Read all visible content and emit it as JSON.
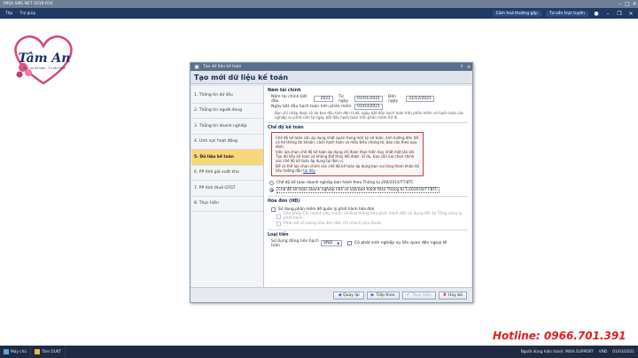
{
  "app": {
    "title": "MISA SME.NET 2019 R16",
    "menus": [
      "Tệp",
      "Trợ giúp"
    ],
    "help_link": "Cảm hoá thường gặp",
    "support_link": "Tư vấn trực tuyến"
  },
  "logo": {
    "brand": "Tâm An",
    "tagline": "Dịch vụ kế toán - Tư vấn thuế"
  },
  "dialog": {
    "window_title": "Tạo dữ liệu kế toán",
    "heading": "Tạo mới dữ liệu kế toán",
    "steps": [
      "1. Thông tin dữ liệu",
      "2. Thông tin người dùng",
      "3. Thông tin doanh nghiệp",
      "4. Lĩnh vực hoạt động",
      "5. Dữ liệu kế toán",
      "6. PP tính giá xuất kho",
      "7. PP tính thuế GTGT",
      "8. Thực hiện"
    ],
    "active_step": 4,
    "fiscal": {
      "section": "Năm tài chính",
      "year_label": "Năm tài chính bắt đầu",
      "year_value": "2021",
      "from_label": "Từ ngày",
      "from_value": "01/01/2021",
      "to_label": "Đến ngày",
      "to_value": "31/12/2021",
      "start_label": "Ngày bắt đầu hạch toán trên phần mềm",
      "start_value": "01/03/2021",
      "note": "Bạn chỉ nhập được số dư ban đầu tính đến trước ngày bắt đầu hạch toán trên phần mềm và hạch toán các nghiệp vụ phát sinh từ ngày bắt đầu hạch toán trên phần mềm trở đi."
    },
    "regime": {
      "section": "Chế độ kế toán",
      "warning_1": "Chế độ kế toán cần áp dụng nhất quán trong một kỳ kế toán, ảnh hưởng đến tất cả hệ thống tài khoản, cách hạch toán và mẫu biểu chứng từ, báo cáo theo quy định.",
      "warning_2": "Việc lựa chọn chế độ kế toán áp dụng chỉ được thực hiện duy nhất một lần khi Tạo dữ liệu kế toán và không thể thay đổi được. Ví dụ, bạn cần lựa chọn chính xác chế độ kế toán áp dụng tại đơn vị.",
      "warning_3": "Để có thể lựa chọn chính xác chế độ kế toán áp dụng bạn vui lòng tham khảo tài liệu hướng dẫn",
      "warning_link": "tại đây",
      "options": [
        "Chế độ kế toán doanh nghiệp ban hành theo Thông tư 200/2014/TT-BTC",
        "Chế độ kế toán doanh nghiệp nhỏ và vừa ban hành theo Thông tư 133/2016/TT-BTC"
      ],
      "selected": 1
    },
    "invoice": {
      "section": "Hóa đơn (HĐ)",
      "opt_1": "Sử dụng phần mềm để quản lý phát hành hóa đơn",
      "opt_2": "Cho phép Chi nhánh phụ thuộc (không thông báo phát hành HĐ) sử dụng HĐ do Tổng công ty phát hành",
      "opt_3": "Phân bổ số lượng hóa đơn đến chi nhánh phụ thuộc"
    },
    "currency": {
      "section": "Loại tiền",
      "label": "Sử dụng đồng tiền hạch toán",
      "value": "VND",
      "foreign_label": "Có phát sinh nghiệp vụ liên quan đến ngoại tệ"
    },
    "buttons": {
      "back": "Quay lại",
      "next": "Tiếp theo",
      "finish": "Thực hiện",
      "cancel": "Hủy bỏ"
    }
  },
  "hotline": "Hotline: 0966.701.391",
  "taskbar": {
    "items": [
      "Máy chủ",
      "Tâm DUKT"
    ],
    "status": [
      "Người dùng hiện hành: MISA.SUPPORT",
      "VNĐ",
      "01/03/2021"
    ]
  },
  "colors": {
    "accent": "#213a63",
    "active_step": "#f7d77a",
    "warning_border": "#d23a3a",
    "hotline": "#e21c1c"
  }
}
